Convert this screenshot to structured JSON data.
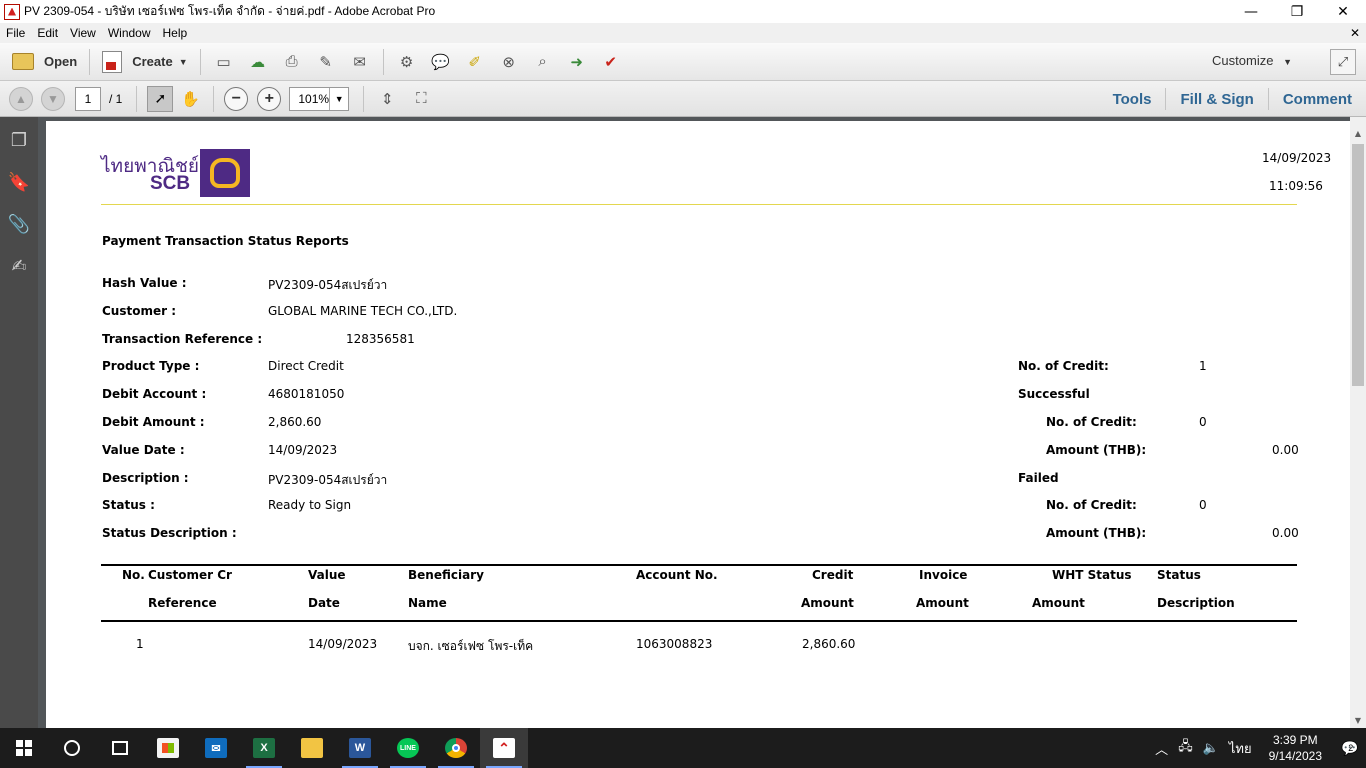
{
  "window": {
    "title": "PV 2309-054 - บริษัท เซอร์เฟซ โพร-เท็ค จำกัด - จ่ายค่.pdf - Adobe Acrobat Pro",
    "minimize_glyph": "—",
    "restore_glyph": "❐",
    "close_glyph": "✕"
  },
  "menu": {
    "items": [
      "File",
      "Edit",
      "View",
      "Window",
      "Help"
    ],
    "close_glyph": "✕"
  },
  "toolbar": {
    "open_label": "Open",
    "create_label": "Create",
    "customize_label": "Customize",
    "icons": [
      "save-icon",
      "upload-icon",
      "print-icon",
      "edit-icon",
      "email-icon",
      "settings-icon",
      "comment-icon",
      "highlight-icon",
      "delete-icon",
      "search-icon",
      "export-icon",
      "stamp-icon"
    ]
  },
  "nav": {
    "page_current": "1",
    "page_total": "/ 1",
    "zoom": "101%"
  },
  "right_tabs": {
    "tools": "Tools",
    "fill_sign": "Fill & Sign",
    "comment": "Comment"
  },
  "doc": {
    "logo_th": "ไทยพาณิชย์",
    "logo_en": "SCB",
    "date": "14/09/2023",
    "time": "11:09:56",
    "report_title": "Payment Transaction Status Reports",
    "fields": {
      "hash_label": "Hash Value :",
      "hash_value": "PV2309-054สเปรย์วา",
      "customer_label": "Customer :",
      "customer_value": "GLOBAL MARINE TECH CO.,LTD.",
      "txref_label": "Transaction Reference :",
      "txref_value": "128356581",
      "product_label": "Product Type :",
      "product_value": "Direct Credit",
      "debit_acc_label": "Debit Account :",
      "debit_acc_value": "4680181050",
      "debit_amt_label": "Debit Amount :",
      "debit_amt_value": "2,860.60",
      "value_date_label": "Value Date :",
      "value_date_value": "14/09/2023",
      "desc_label": "Description :",
      "desc_value": "PV2309-054สเปรย์วา",
      "status_label": "Status :",
      "status_value": "Ready to Sign",
      "status_desc_label": "Status Description :"
    },
    "summary": {
      "credit_count_label": "No. of Credit:",
      "credit_count_value": "1",
      "successful_label": "Successful",
      "succ_credit_label": "No. of Credit:",
      "succ_credit_value": "0",
      "succ_amount_label": "Amount (THB):",
      "succ_amount_value": "0.00",
      "failed_label": "Failed",
      "fail_credit_label": "No. of Credit:",
      "fail_credit_value": "0",
      "fail_amount_label": "Amount (THB):",
      "fail_amount_value": "0.00"
    },
    "table": {
      "h_no": "No.",
      "h_cust1": "Customer Cr",
      "h_cust2": "Reference",
      "h_value1": "Value",
      "h_value2": "Date",
      "h_benef1": "Beneficiary",
      "h_benef2": "Name",
      "h_account": "Account No.",
      "h_credit1": "Credit",
      "h_credit2": "Amount",
      "h_invoice1": "Invoice",
      "h_invoice2": "Amount",
      "h_wht1": "WHT Status",
      "h_wht2": "Amount",
      "h_status1": "Status",
      "h_status2": "Description",
      "rows": [
        {
          "no": "1",
          "value_date": "14/09/2023",
          "beneficiary": "บจก. เซอร์เฟซ โพร-เท็ค",
          "account": "1063008823",
          "credit": "2,860.60"
        }
      ]
    }
  },
  "taskbar": {
    "time": "3:39 PM",
    "date": "9/14/2023",
    "lang": "ไทย",
    "notif_count": "2",
    "excel_letter": "X",
    "word_letter": "W",
    "line_label": "LINE"
  }
}
